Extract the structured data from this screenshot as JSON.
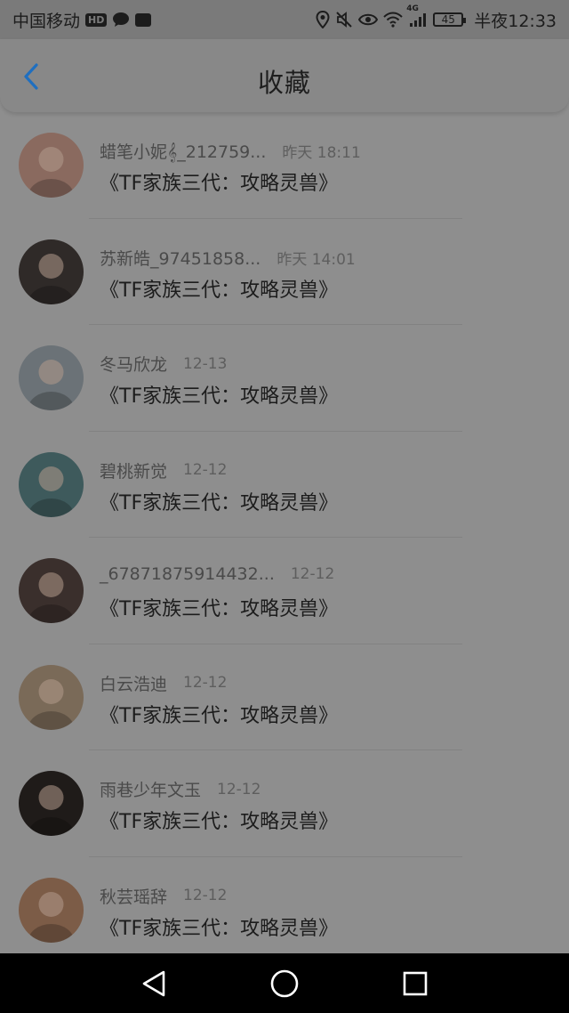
{
  "status_bar": {
    "carrier": "中国移动",
    "hd_badge": "HD",
    "network": "4G",
    "battery": "45",
    "time": "半夜12:33",
    "icons": [
      "message-icon",
      "notification-icon",
      "location-icon",
      "mute-icon",
      "eye-icon",
      "wifi-icon",
      "signal-icon",
      "battery-icon"
    ]
  },
  "header": {
    "title": "收藏",
    "back_icon": "chevron-left-icon",
    "accent_color": "#1f6fc0"
  },
  "items": [
    {
      "name": "蜡笔小妮𝄞_212759...",
      "time": "昨天 18:11",
      "title": "《TF家族三代：攻略灵兽》",
      "avatar_color": "#8a6a5f"
    },
    {
      "name": "苏新皓_97451858...",
      "time": "昨天 14:01",
      "title": "《TF家族三代：攻略灵兽》",
      "avatar_color": "#2f2a28"
    },
    {
      "name": "冬马欣龙",
      "time": "12-13",
      "title": "《TF家族三代：攻略灵兽》",
      "avatar_color": "#6b7277"
    },
    {
      "name": "碧桃新觉",
      "time": "12-12",
      "title": "《TF家族三代：攻略灵兽》",
      "avatar_color": "#3e5a5c"
    },
    {
      "name": "_67871875914432...",
      "time": "12-12",
      "title": "《TF家族三代：攻略灵兽》",
      "avatar_color": "#3a2f2c"
    },
    {
      "name": "白云浩迪",
      "time": "12-12",
      "title": "《TF家族三代：攻略灵兽》",
      "avatar_color": "#7a6a58"
    },
    {
      "name": "雨巷少年文玉",
      "time": "12-12",
      "title": "《TF家族三代：攻略灵兽》",
      "avatar_color": "#1f1b19"
    },
    {
      "name": "秋芸瑶辞",
      "time": "12-12",
      "title": "《TF家族三代：攻略灵兽》",
      "avatar_color": "#7c5c47"
    }
  ],
  "system_nav": {
    "icons": [
      "back-triangle-icon",
      "home-circle-icon",
      "recents-square-icon"
    ]
  }
}
